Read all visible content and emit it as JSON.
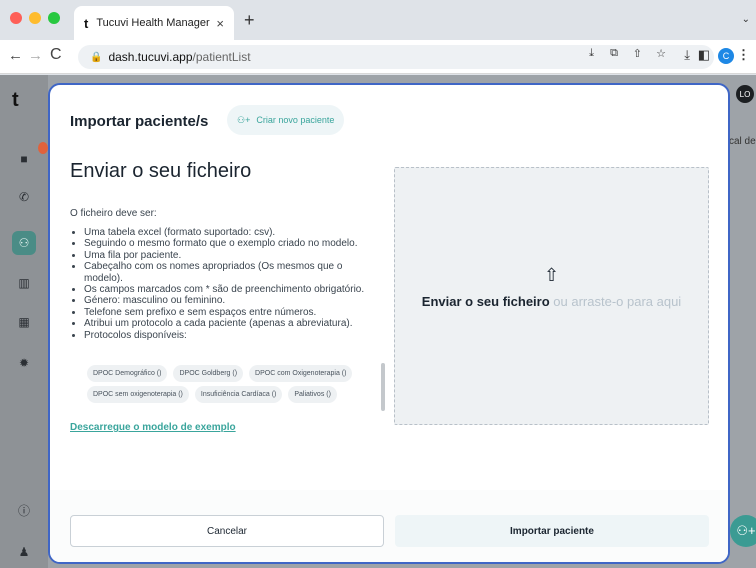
{
  "browser": {
    "tab_title": "Tucuvi Health Manager",
    "tab_logo": "t",
    "tab_close": "×",
    "new_tab": "+",
    "tabs_menu": "⌄",
    "url_host": "dash.tucuvi.app",
    "url_path": "/patientList",
    "profile_initial": "C",
    "icons": [
      "back-icon",
      "forward-icon",
      "reload-icon",
      "lock-icon",
      "install-icon",
      "translate-icon",
      "share-icon",
      "bookmark-star-icon",
      "download-icon",
      "sidepanel-icon",
      "profile-icon",
      "kebab-menu-icon"
    ]
  },
  "app": {
    "logo": "t",
    "avatar": "LO",
    "column_header_fragment": "cal de a",
    "sidebar_icons": [
      "dashboard-icon",
      "phone-icon",
      "patients-icon",
      "chart-icon",
      "calendar-icon",
      "settings-icon",
      "info-icon",
      "user-icon"
    ]
  },
  "modal": {
    "title": "Importar paciente/s",
    "create_button": "Criar novo paciente",
    "section_title": "Enviar o seu ficheiro",
    "subtitle": "O ficheiro deve ser:",
    "requirements": [
      "Uma tabela excel (formato suportado: csv).",
      "Seguindo o mesmo formato que o exemplo criado no modelo.",
      "Uma fila por paciente.",
      "Cabeçalho com os nomes apropriados (Os mesmos que o modelo).",
      "Os campos marcados com * são de preenchimento obrigatório.",
      "Género: masculino ou feminino.",
      "Telefone sem prefixo e sem espaços entre números.",
      "Atribui um protocolo a cada paciente (apenas a abreviatura).",
      "Protocolos disponíveis:"
    ],
    "protocols": [
      "DPOC Demográfico ()",
      "DPOC Goldberg ()",
      "DPOC com Oxigenoterapia ()",
      "DPOC sem oxigenoterapia ()",
      "Insuficiência Cardíaca ()",
      "Paliativos ()"
    ],
    "download_link": "Descarregue o modelo de exemplo",
    "dropzone": {
      "strong": "Enviar o seu ficheiro",
      "light": " ou arraste-o para aqui"
    },
    "cancel_button": "Cancelar",
    "import_button": "Importar paciente"
  },
  "colors": {
    "accent": "#3aa59c",
    "modal_border": "#3f66c6",
    "text": "#1b2530"
  }
}
